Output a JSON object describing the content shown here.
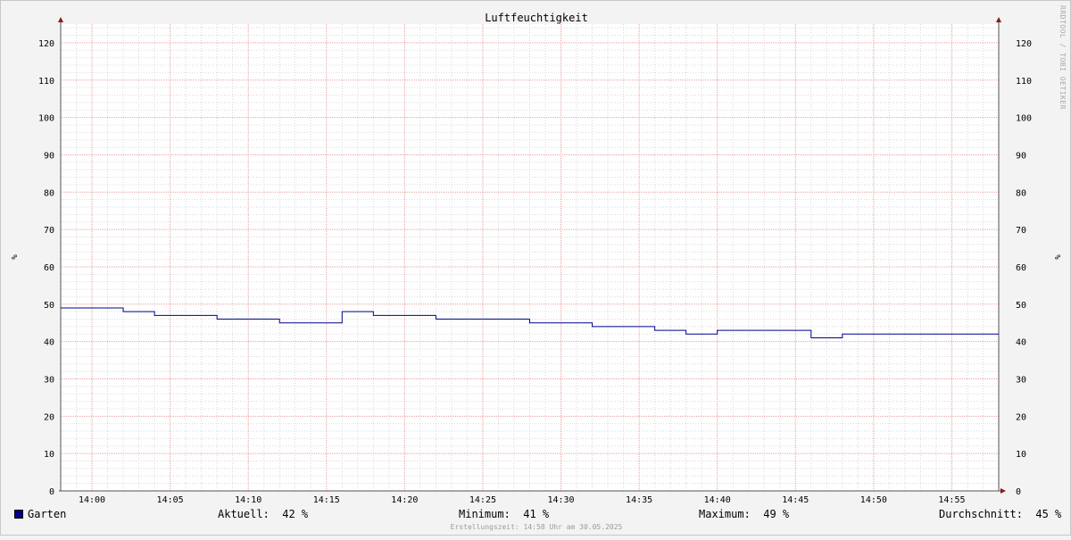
{
  "chart_data": {
    "type": "line",
    "title": "Luftfeuchtigkeit",
    "ylabel": "%",
    "y2label": "%",
    "ylim": [
      0,
      125
    ],
    "y_ticks": [
      0,
      10,
      20,
      30,
      40,
      50,
      60,
      70,
      80,
      90,
      100,
      110,
      120
    ],
    "x_tick_labels": [
      "14:00",
      "14:05",
      "14:10",
      "14:15",
      "14:20",
      "14:25",
      "14:30",
      "14:35",
      "14:40",
      "14:45",
      "14:50",
      "14:55"
    ],
    "x_tick_values": [
      0,
      5,
      10,
      15,
      20,
      25,
      30,
      35,
      40,
      45,
      50,
      55
    ],
    "xlim": [
      -2,
      58
    ],
    "grid": true,
    "series": [
      {
        "name": "Garten",
        "color": "#00008b",
        "step": true,
        "x": [
          -2,
          2,
          4,
          8,
          12,
          16,
          18,
          22,
          28,
          32,
          36,
          38,
          40,
          46,
          48,
          58
        ],
        "y": [
          49,
          48,
          47,
          46,
          45,
          48,
          47,
          46,
          45,
          44,
          43,
          42,
          43,
          41,
          42,
          42
        ]
      }
    ]
  },
  "legend": {
    "series_name": "Garten",
    "current_label": "Aktuell:",
    "current_value": "42 %",
    "min_label": "Minimum:",
    "min_value": "41 %",
    "max_label": "Maximum:",
    "max_value": "49 %",
    "avg_label": "Durchschnitt:",
    "avg_value": "45 %"
  },
  "footer": "Erstellungszeit: 14:58 Uhr am 30.05.2025",
  "watermark": "RRDTOOL / TOBI OETIKER",
  "colors": {
    "background": "#f3f3f3",
    "plot_background": "#ffffff",
    "major_grid": "#e8a0a0",
    "minor_grid": "#d9d9d9",
    "axis": "#555555",
    "arrow": "#8b1a1a",
    "series": "#00008b"
  }
}
